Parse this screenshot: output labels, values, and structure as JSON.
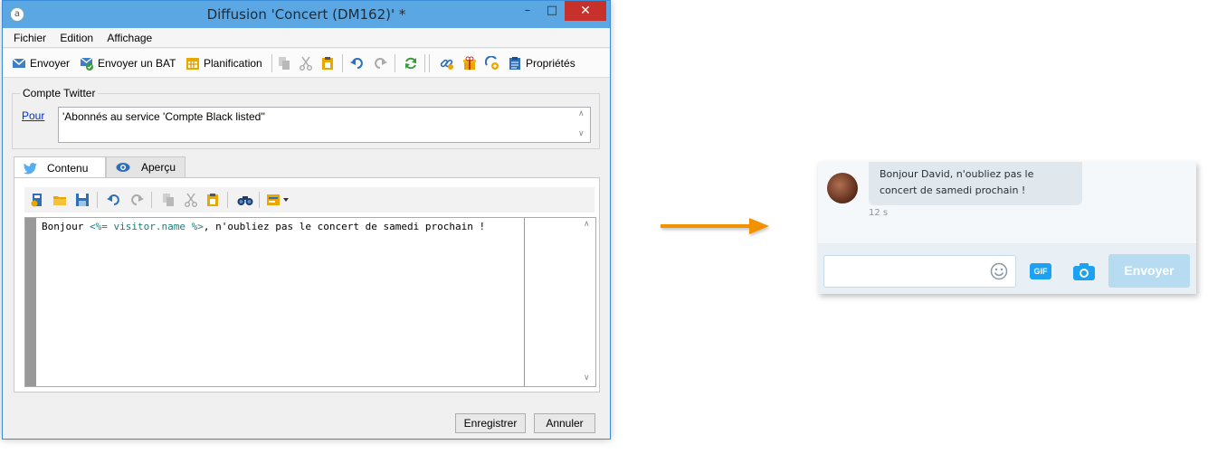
{
  "window": {
    "title": "Diffusion 'Concert (DM162)' *",
    "app_icon_glyph": "a"
  },
  "menu": [
    "Fichier",
    "Edition",
    "Affichage"
  ],
  "toolbar": {
    "send_label": "Envoyer",
    "proof_label": "Envoyer un BAT",
    "schedule_label": "Planification",
    "properties_label": "Propriétés"
  },
  "twitter_account": {
    "group_label": "Compte Twitter",
    "to_link": "Pour",
    "to_value": "'Abonnés au service 'Compte Black listed''"
  },
  "tabs": [
    {
      "label": "Contenu",
      "icon": "twitter-bird-icon",
      "active": true
    },
    {
      "label": "Aperçu",
      "icon": "eye-icon",
      "active": false
    }
  ],
  "editor": {
    "text_before": "Bonjour ",
    "personalization": "<%= visitor.name %>",
    "text_after": ", n'oubliez pas le concert de samedi prochain !"
  },
  "buttons": {
    "save": "Enregistrer",
    "cancel": "Annuler"
  },
  "preview": {
    "message": "Bonjour David, n'oubliez pas le concert de samedi prochain !",
    "time": "12 s",
    "gif_label": "GIF",
    "send_label": "Envoyer"
  },
  "colors": {
    "titlebar": "#5aa7e4",
    "arrow": "#f39200",
    "twitter_blue": "#1da1f2",
    "send_disabled": "#b7dcf2"
  }
}
